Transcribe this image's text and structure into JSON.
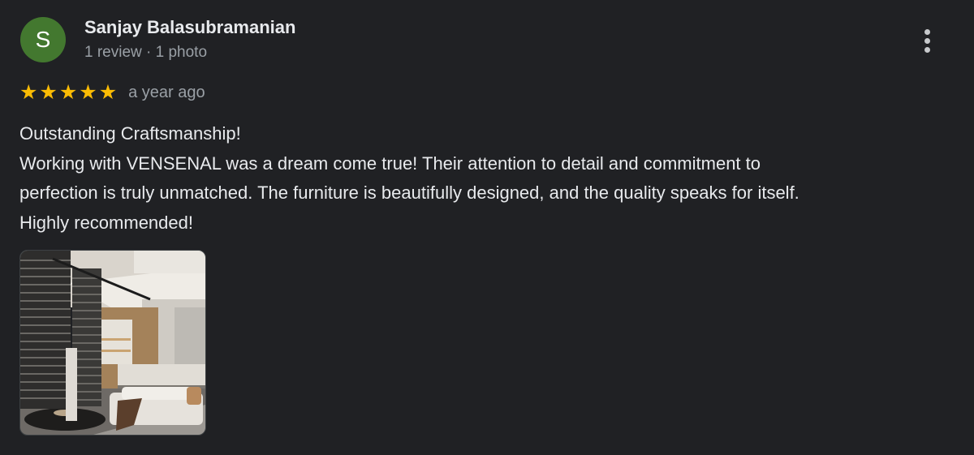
{
  "reviewer": {
    "initial": "S",
    "name": "Sanjay Balasubramanian",
    "meta": "1 review · 1 photo",
    "avatar_color": "#43782f"
  },
  "review": {
    "rating": 5,
    "max_rating": 5,
    "stars": [
      "★",
      "★",
      "★",
      "★",
      "★"
    ],
    "star_color": "#fbbc04",
    "date": "a year ago",
    "lines": [
      "Outstanding Craftsmanship!",
      "Working with VENSENAL was a dream come true! Their attention to detail and commitment to",
      "perfection is truly unmatched. The furniture is beautifully designed, and the quality speaks for itself.",
      "Highly recommended!"
    ]
  },
  "menu": {
    "icon": "more-vertical-icon"
  },
  "photo": {
    "subject": "interior-living-room-photo"
  }
}
